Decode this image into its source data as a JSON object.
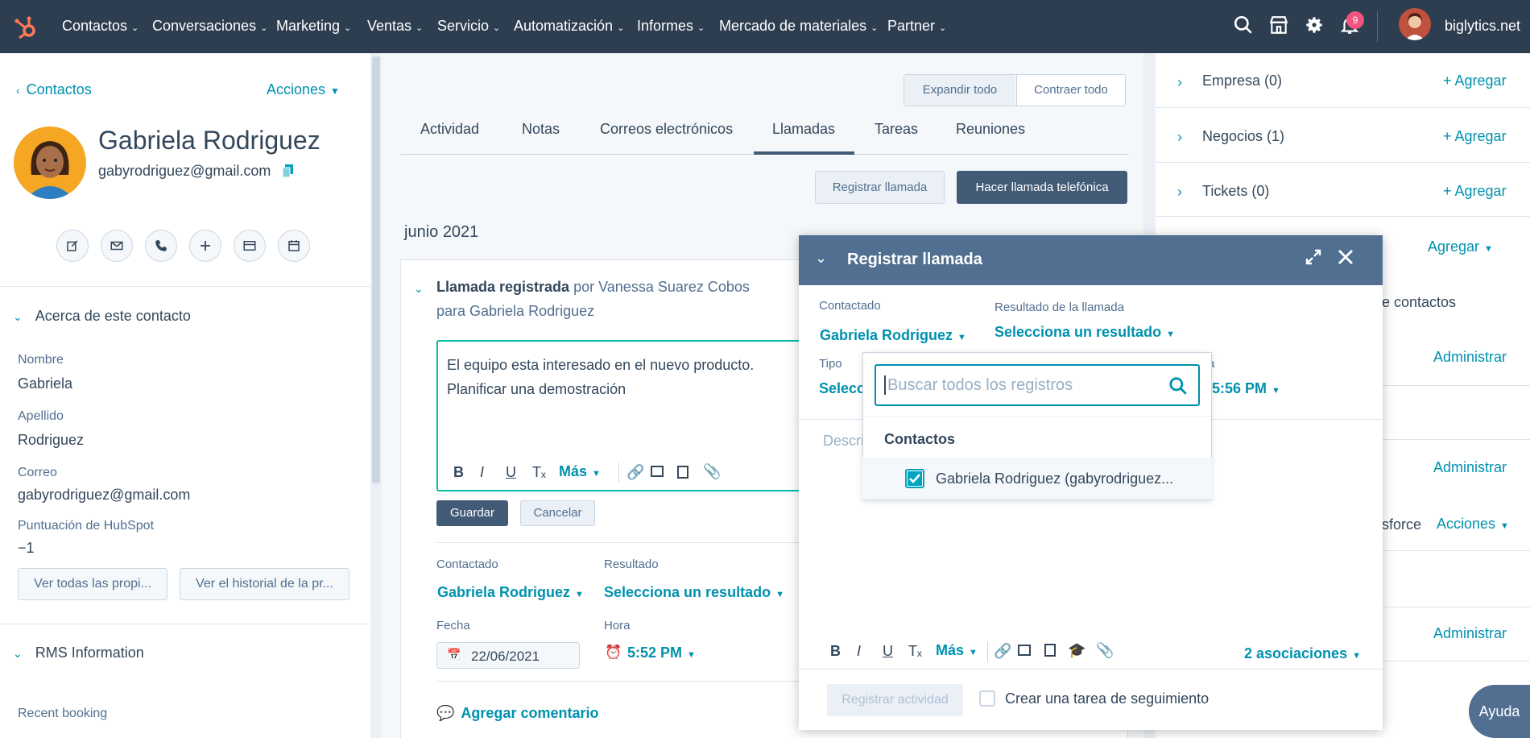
{
  "topnav": {
    "items": [
      "Contactos",
      "Conversaciones",
      "Marketing",
      "Ventas",
      "Servicio",
      "Automatización",
      "Informes",
      "Mercado de materiales",
      "Partner"
    ],
    "notification_count": "9",
    "account": "biglytics.net"
  },
  "left": {
    "back_link": "Contactos",
    "actions": "Acciones",
    "contact_name": "Gabriela Rodriguez",
    "contact_email": "gabyrodriguez@gmail.com",
    "about_header": "Acerca de este contacto",
    "props": [
      {
        "label": "Nombre",
        "value": "Gabriela"
      },
      {
        "label": "Apellido",
        "value": "Rodriguez"
      },
      {
        "label": "Correo",
        "value": "gabyrodriguez@gmail.com"
      },
      {
        "label": "Puntuación de HubSpot",
        "value": "−1"
      }
    ],
    "btn_all_props": "Ver todas las propi...",
    "btn_history": "Ver el historial de la pr...",
    "rms_header": "RMS Information",
    "recent_booking": "Recent booking"
  },
  "middle": {
    "expand_all": "Expandir todo",
    "collapse_all": "Contraer todo",
    "tabs": [
      "Actividad",
      "Notas",
      "Correos electrónicos",
      "Llamadas",
      "Tareas",
      "Reuniones"
    ],
    "btn_log_call": "Registrar llamada",
    "btn_make_call": "Hacer llamada telefónica",
    "month": "junio 2021",
    "activity_title": "Llamada registrada",
    "activity_by": "por Vanessa Suarez Cobos",
    "activity_for": "para Gabriela Rodriguez",
    "note_line1": "El equipo esta interesado en el nuevo producto.",
    "note_line2": "Planificar una demostración",
    "more": "Más",
    "save": "Guardar",
    "cancel": "Cancelar",
    "contacted_label": "Contactado",
    "contacted_value": "Gabriela Rodriguez",
    "result_label": "Resultado",
    "result_value": "Selecciona un resultado",
    "date_label": "Fecha",
    "date_value": "22/06/2021",
    "time_label": "Hora",
    "time_value": "5:52 PM",
    "add_comment": "Agregar comentario"
  },
  "right": {
    "rows": [
      {
        "label": "Empresa (0)",
        "action": "+ Agregar"
      },
      {
        "label": "Negocios (1)",
        "action": "+ Agregar"
      },
      {
        "label": "Tickets (0)",
        "action": "+ Agregar"
      }
    ],
    "agregar": "Agregar",
    "contactos_partial": "e contactos",
    "administrar_1": "Administrar",
    "administrar_2": "Administrar",
    "sforce_partial": "sforce",
    "acciones": "Acciones",
    "administrar_3": "Administrar"
  },
  "modal": {
    "title": "Registrar llamada",
    "contacted_label": "Contactado",
    "contacted_value": "Gabriela Rodriguez",
    "result_label": "Resultado de la llamada",
    "result_value": "Selecciona un resultado",
    "type_label": "Tipo",
    "type_value": "Selecci",
    "time_label_partial": "a",
    "time_value": "5:56 PM",
    "desc_placeholder": "Descri",
    "search_placeholder": "Buscar todos los registros",
    "dd_section": "Contactos",
    "dd_item": "Gabriela Rodriguez (gabyrodriguez...",
    "more": "Más",
    "associations": "2 asociaciones",
    "log_activity": "Registrar actividad",
    "followup": "Crear una tarea de seguimiento"
  },
  "help": "Ayuda",
  "colors": {
    "accent": "#0091ae",
    "nav": "#2d3e50",
    "modal_header": "#516f90",
    "primary_btn": "#425b76"
  }
}
